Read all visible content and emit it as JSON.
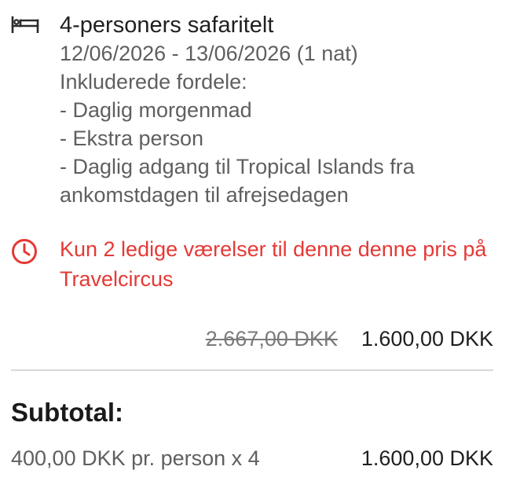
{
  "room": {
    "icon": "bed-icon",
    "title": "4-personers safaritelt",
    "dates": "12/06/2026 - 13/06/2026 (1 nat)",
    "benefits_heading": "Inkluderede fordele:",
    "benefits": [
      "- Daglig morgenmad",
      "- Ekstra person",
      "- Daglig adgang til Tropical Islands fra ankomstdagen til afrejsedagen"
    ]
  },
  "availability_alert": {
    "icon": "clock-icon",
    "text": "Kun 2 ledige værelser til denne denne pris på Travelcircus",
    "color": "#e53935"
  },
  "price": {
    "original": "2.667,00 DKK",
    "discounted": "1.600,00 DKK"
  },
  "subtotal": {
    "heading": "Subtotal:",
    "detail": "400,00 DKK pr. person x 4",
    "amount": "1.600,00 DKK"
  }
}
